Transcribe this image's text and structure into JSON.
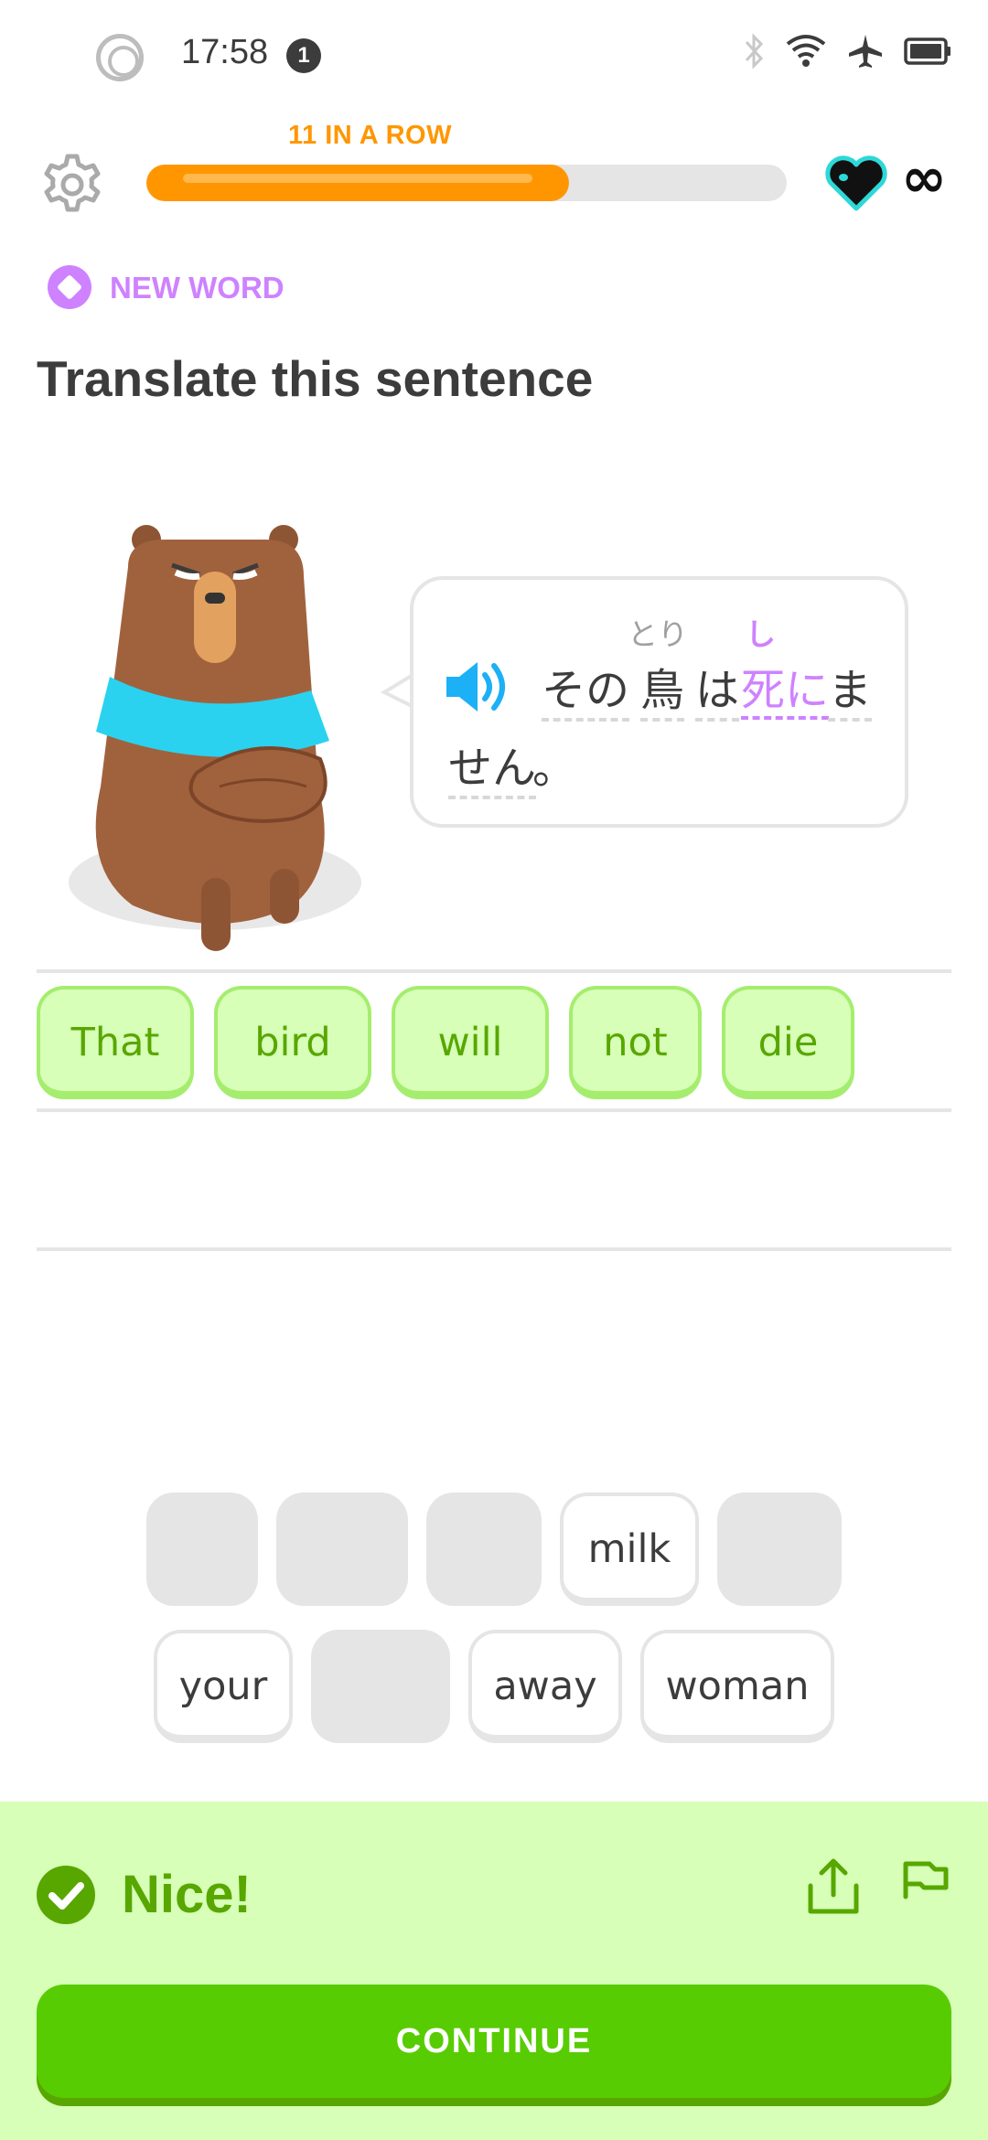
{
  "status_bar": {
    "time": "17:58",
    "notification_count": "1"
  },
  "header": {
    "streak_label": "11 IN A ROW",
    "progress_fraction": 0.66,
    "hearts": "∞"
  },
  "badge": {
    "label": "NEW WORD",
    "color": "#ce82ff"
  },
  "instruction": "Translate this sentence",
  "sentence": {
    "words": [
      {
        "text": "その",
        "furigana": ""
      },
      {
        "text": "鳥",
        "furigana": "とり"
      },
      {
        "text": "は",
        "furigana": ""
      },
      {
        "text": "死に",
        "furigana": "し",
        "new": true
      },
      {
        "text": "ま",
        "furigana": ""
      },
      {
        "text": "せん",
        "furigana": ""
      },
      {
        "text": "。",
        "furigana": ""
      }
    ]
  },
  "answer_tiles": [
    "That",
    "bird",
    "will",
    "not",
    "die"
  ],
  "word_bank": {
    "row1": [
      "",
      "",
      "",
      "milk",
      ""
    ],
    "row2": [
      "your",
      "",
      "away",
      "woman"
    ]
  },
  "feedback": {
    "title": "Nice!",
    "button": "CONTINUE"
  },
  "colors": {
    "accent_green": "#58cc02",
    "streak_orange": "#ff9600",
    "feedback_bg": "#d7ffb8",
    "new_word_purple": "#ce82ff"
  }
}
